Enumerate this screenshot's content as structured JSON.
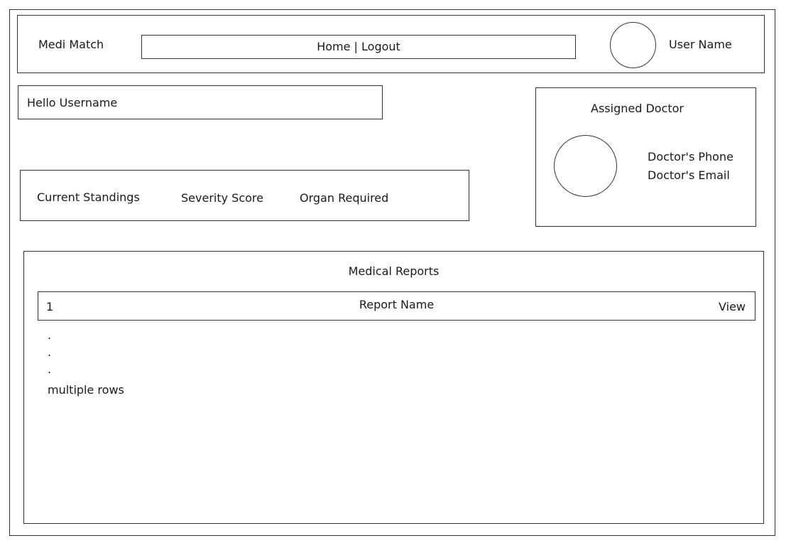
{
  "header": {
    "app_title": "Medi Match",
    "nav": {
      "home_label": "Home",
      "separator": "|",
      "logout_label": "Logout"
    },
    "user_name": "User Name",
    "avatar_icon": "avatar-circle"
  },
  "greeting": {
    "text": "Hello Username"
  },
  "standings": {
    "current_standings_label": "Current Standings",
    "severity_score_label": "Severity Score",
    "organ_required_label": "Organ Required"
  },
  "doctor": {
    "title": "Assigned Doctor",
    "phone_label": "Doctor's Phone",
    "email_label": "Doctor's Email",
    "avatar_icon": "doctor-avatar-circle"
  },
  "reports": {
    "title": "Medical Reports",
    "rows": [
      {
        "index": "1",
        "name": "Report Name",
        "action": "View"
      }
    ],
    "placeholder_dots": [
      ".",
      ".",
      "."
    ],
    "placeholder_note": "multiple rows"
  }
}
